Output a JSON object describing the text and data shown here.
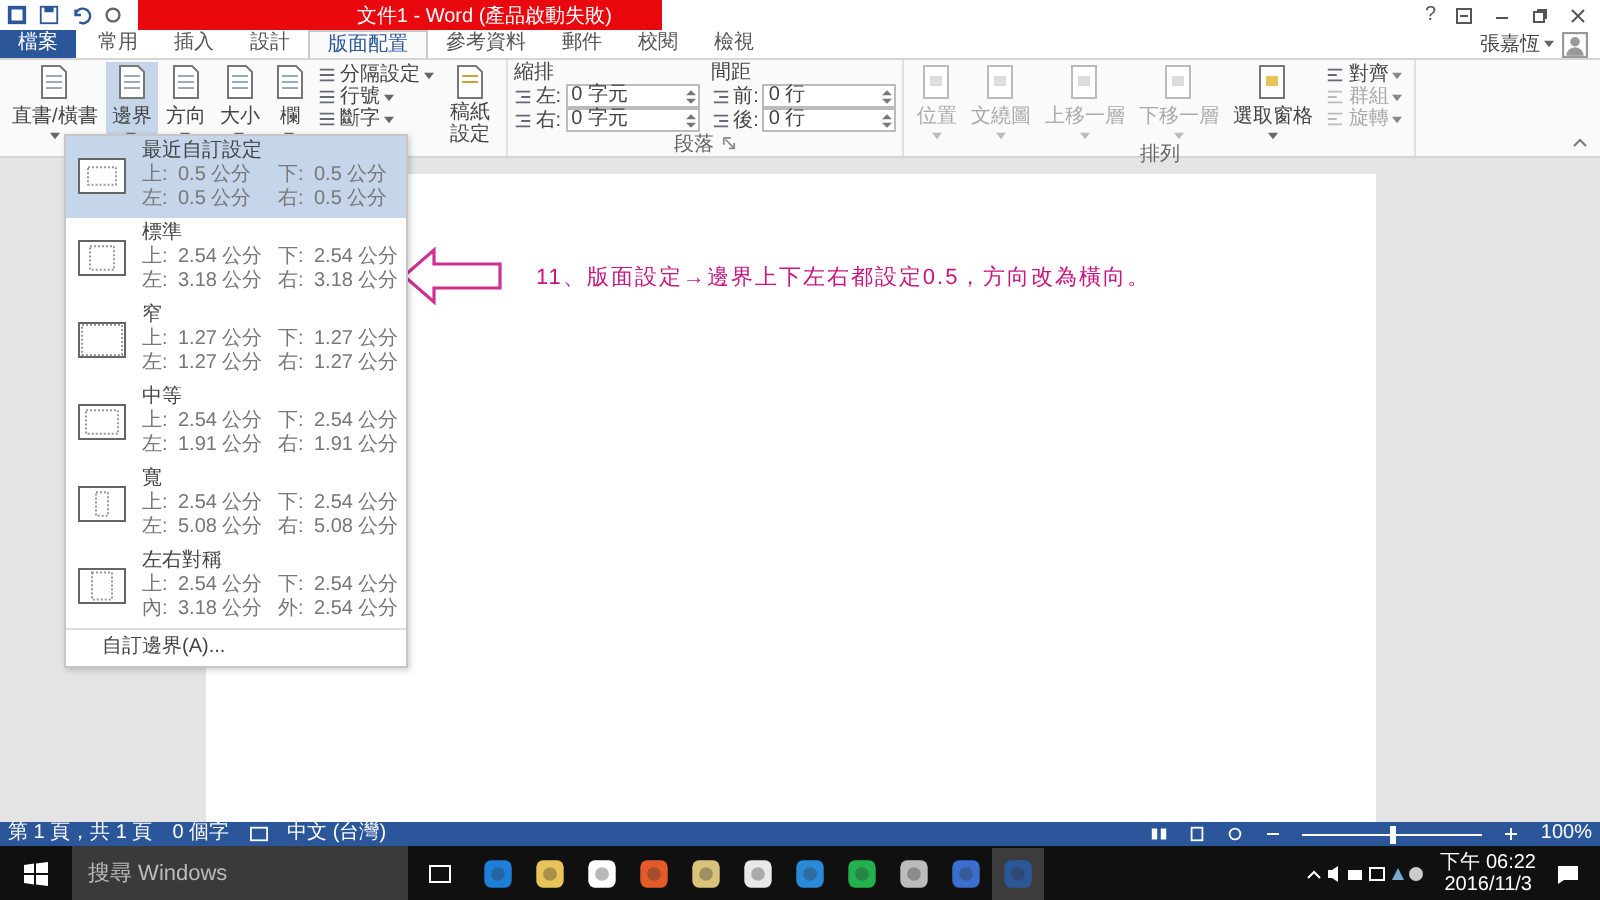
{
  "window": {
    "title": "文件1 - Word (產品啟動失敗)",
    "help": "?",
    "user": "張嘉恆"
  },
  "tabs": [
    {
      "label": "檔案",
      "kind": "file",
      "selected": false
    },
    {
      "label": "常用",
      "kind": "tab",
      "selected": false
    },
    {
      "label": "插入",
      "kind": "tab",
      "selected": false
    },
    {
      "label": "設計",
      "kind": "tab",
      "selected": false
    },
    {
      "label": "版面配置",
      "kind": "tab",
      "selected": true
    },
    {
      "label": "參考資料",
      "kind": "tab",
      "selected": false
    },
    {
      "label": "郵件",
      "kind": "tab",
      "selected": false
    },
    {
      "label": "校閱",
      "kind": "tab",
      "selected": false
    },
    {
      "label": "檢視",
      "kind": "tab",
      "selected": false
    }
  ],
  "ribbon": {
    "page_setup": {
      "large": [
        {
          "label": "直書/橫書",
          "selected": false
        },
        {
          "label": "邊界",
          "selected": true
        },
        {
          "label": "方向",
          "selected": false
        },
        {
          "label": "大小",
          "selected": false
        },
        {
          "label": "欄",
          "selected": false
        }
      ],
      "small": [
        {
          "label": "分隔設定"
        },
        {
          "label": "行號"
        },
        {
          "label": "斷字"
        }
      ],
      "manuscript": "稿紙設定"
    },
    "paragraph": {
      "label": "段落",
      "columns": [
        {
          "title": "縮排",
          "fields": [
            {
              "label": "左:",
              "value": "0 字元"
            },
            {
              "label": "右:",
              "value": "0 字元"
            }
          ]
        },
        {
          "title": "間距",
          "fields": [
            {
              "label": "前:",
              "value": "0 行"
            },
            {
              "label": "後:",
              "value": "0 行"
            }
          ]
        }
      ]
    },
    "arrange": {
      "label": "排列",
      "large": [
        {
          "label": "位置",
          "disabled": true
        },
        {
          "label": "文繞圖",
          "disabled": true
        },
        {
          "label": "上移一層",
          "disabled": true
        },
        {
          "label": "下移一層",
          "disabled": true
        },
        {
          "label": "選取窗格",
          "disabled": false
        }
      ],
      "small": [
        {
          "label": "對齊",
          "disabled": false
        },
        {
          "label": "群組",
          "disabled": true
        },
        {
          "label": "旋轉",
          "disabled": true
        }
      ]
    }
  },
  "margins_menu": {
    "items": [
      {
        "name": "最近自訂設定",
        "selected": true,
        "rows": [
          [
            "上:",
            "0.5 公分",
            "下:",
            "0.5 公分"
          ],
          [
            "左:",
            "0.5 公分",
            "右:",
            "0.5 公分"
          ]
        ]
      },
      {
        "name": "標準",
        "selected": false,
        "rows": [
          [
            "上:",
            "2.54 公分",
            "下:",
            "2.54 公分"
          ],
          [
            "左:",
            "3.18 公分",
            "右:",
            "3.18 公分"
          ]
        ]
      },
      {
        "name": "窄",
        "selected": false,
        "rows": [
          [
            "上:",
            "1.27 公分",
            "下:",
            "1.27 公分"
          ],
          [
            "左:",
            "1.27 公分",
            "右:",
            "1.27 公分"
          ]
        ]
      },
      {
        "name": "中等",
        "selected": false,
        "rows": [
          [
            "上:",
            "2.54 公分",
            "下:",
            "2.54 公分"
          ],
          [
            "左:",
            "1.91 公分",
            "右:",
            "1.91 公分"
          ]
        ]
      },
      {
        "name": "寬",
        "selected": false,
        "rows": [
          [
            "上:",
            "2.54 公分",
            "下:",
            "2.54 公分"
          ],
          [
            "左:",
            "5.08 公分",
            "右:",
            "5.08 公分"
          ]
        ]
      },
      {
        "name": "左右對稱",
        "selected": false,
        "rows": [
          [
            "上:",
            "2.54 公分",
            "下:",
            "2.54 公分"
          ],
          [
            "內:",
            "3.18 公分",
            "外:",
            "2.54 公分"
          ]
        ]
      }
    ],
    "footer": "自訂邊界(A)..."
  },
  "annotation": "11、版面設定→邊界上下左右都設定0.5，方向改為橫向。",
  "status_bar": {
    "page": "第 1 頁，共 1 頁",
    "words": "0 個字",
    "language": "中文 (台灣)",
    "zoom": {
      "level": 0.5,
      "reading": "100%"
    }
  },
  "taskbar": {
    "search_placeholder": "搜尋 Windows",
    "time": "下午 06:22",
    "date": "2016/11/3"
  }
}
